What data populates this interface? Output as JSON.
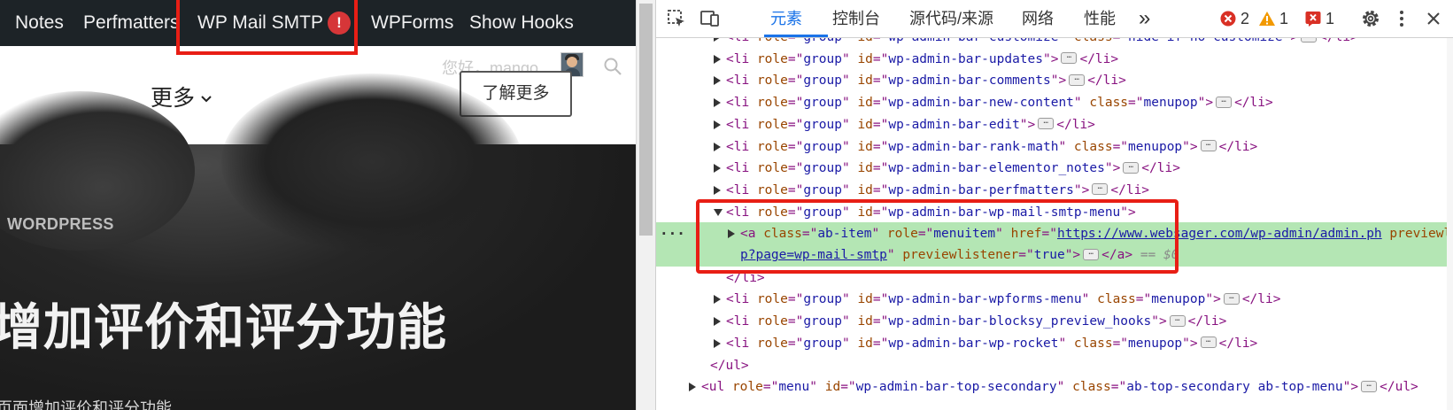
{
  "preview": {
    "admin_bar": {
      "items": [
        "Notes",
        "Perfmatters",
        "WP Mail SMTP",
        "WPForms",
        "Show Hooks"
      ],
      "smtp_badge": "!"
    },
    "greeting": "您好，mango",
    "more_label": "更多",
    "learn_more": "了解更多",
    "category": "WORDPRESS",
    "headline": "增加评价和评分功能",
    "subline": "页面增加评价和评分功能"
  },
  "devtools": {
    "tabs": [
      "元素",
      "控制台",
      "源代码/来源",
      "网络",
      "性能"
    ],
    "active_tab": "元素",
    "more_tabs": "»",
    "errors": "2",
    "warnings": "1",
    "issues": "1",
    "accent_color": "#1a73e8",
    "error_color": "#d93025",
    "warning_color": "#f29900",
    "selected_marker": "== $0",
    "lines": [
      {
        "tag": "li",
        "attrs": [
          [
            "role",
            "group"
          ],
          [
            "id",
            "wp-admin-bar-customize"
          ],
          [
            "class",
            "hide-if-no-customize"
          ]
        ],
        "collapsed": true
      },
      {
        "tag": "li",
        "attrs": [
          [
            "role",
            "group"
          ],
          [
            "id",
            "wp-admin-bar-updates"
          ]
        ],
        "collapsed": true
      },
      {
        "tag": "li",
        "attrs": [
          [
            "role",
            "group"
          ],
          [
            "id",
            "wp-admin-bar-comments"
          ]
        ],
        "collapsed": true
      },
      {
        "tag": "li",
        "attrs": [
          [
            "role",
            "group"
          ],
          [
            "id",
            "wp-admin-bar-new-content"
          ],
          [
            "class",
            "menupop"
          ]
        ],
        "collapsed": true
      },
      {
        "tag": "li",
        "attrs": [
          [
            "role",
            "group"
          ],
          [
            "id",
            "wp-admin-bar-edit"
          ]
        ],
        "collapsed": true
      },
      {
        "tag": "li",
        "attrs": [
          [
            "role",
            "group"
          ],
          [
            "id",
            "wp-admin-bar-rank-math"
          ],
          [
            "class",
            "menupop"
          ]
        ],
        "collapsed": true
      },
      {
        "tag": "li",
        "attrs": [
          [
            "role",
            "group"
          ],
          [
            "id",
            "wp-admin-bar-elementor_notes"
          ]
        ],
        "collapsed": true
      },
      {
        "tag": "li",
        "attrs": [
          [
            "role",
            "group"
          ],
          [
            "id",
            "wp-admin-bar-perfmatters"
          ]
        ],
        "collapsed": true
      },
      {
        "tag": "li",
        "attrs": [
          [
            "role",
            "group"
          ],
          [
            "id",
            "wp-admin-bar-wp-mail-smtp-menu"
          ]
        ],
        "collapsed": false
      },
      {
        "tag": "a",
        "attrs": [
          [
            "class",
            "ab-item"
          ],
          [
            "role",
            "menuitem"
          ],
          [
            "href",
            "https://www.websager.com/wp-admin/admin.php?page=wp-mail-smtp"
          ],
          [
            "previewlistener",
            "true"
          ]
        ],
        "collapsed": true,
        "selected": true,
        "href_part1": "https://www.websager.com/wp-admin/admin.ph",
        "href_part2": "p?page=wp-mail-smtp"
      },
      {
        "close": "li"
      },
      {
        "tag": "li",
        "attrs": [
          [
            "role",
            "group"
          ],
          [
            "id",
            "wp-admin-bar-wpforms-menu"
          ],
          [
            "class",
            "menupop"
          ]
        ],
        "collapsed": true
      },
      {
        "tag": "li",
        "attrs": [
          [
            "role",
            "group"
          ],
          [
            "id",
            "wp-admin-bar-blocksy_preview_hooks"
          ]
        ],
        "collapsed": true
      },
      {
        "tag": "li",
        "attrs": [
          [
            "role",
            "group"
          ],
          [
            "id",
            "wp-admin-bar-wp-rocket"
          ],
          [
            "class",
            "menupop"
          ]
        ],
        "collapsed": true
      },
      {
        "close": "ul"
      },
      {
        "tag": "ul",
        "attrs": [
          [
            "role",
            "menu"
          ],
          [
            "id",
            "wp-admin-bar-top-secondary"
          ],
          [
            "class",
            "ab-top-secondary ab-top-menu"
          ]
        ],
        "collapsed": true
      }
    ]
  }
}
